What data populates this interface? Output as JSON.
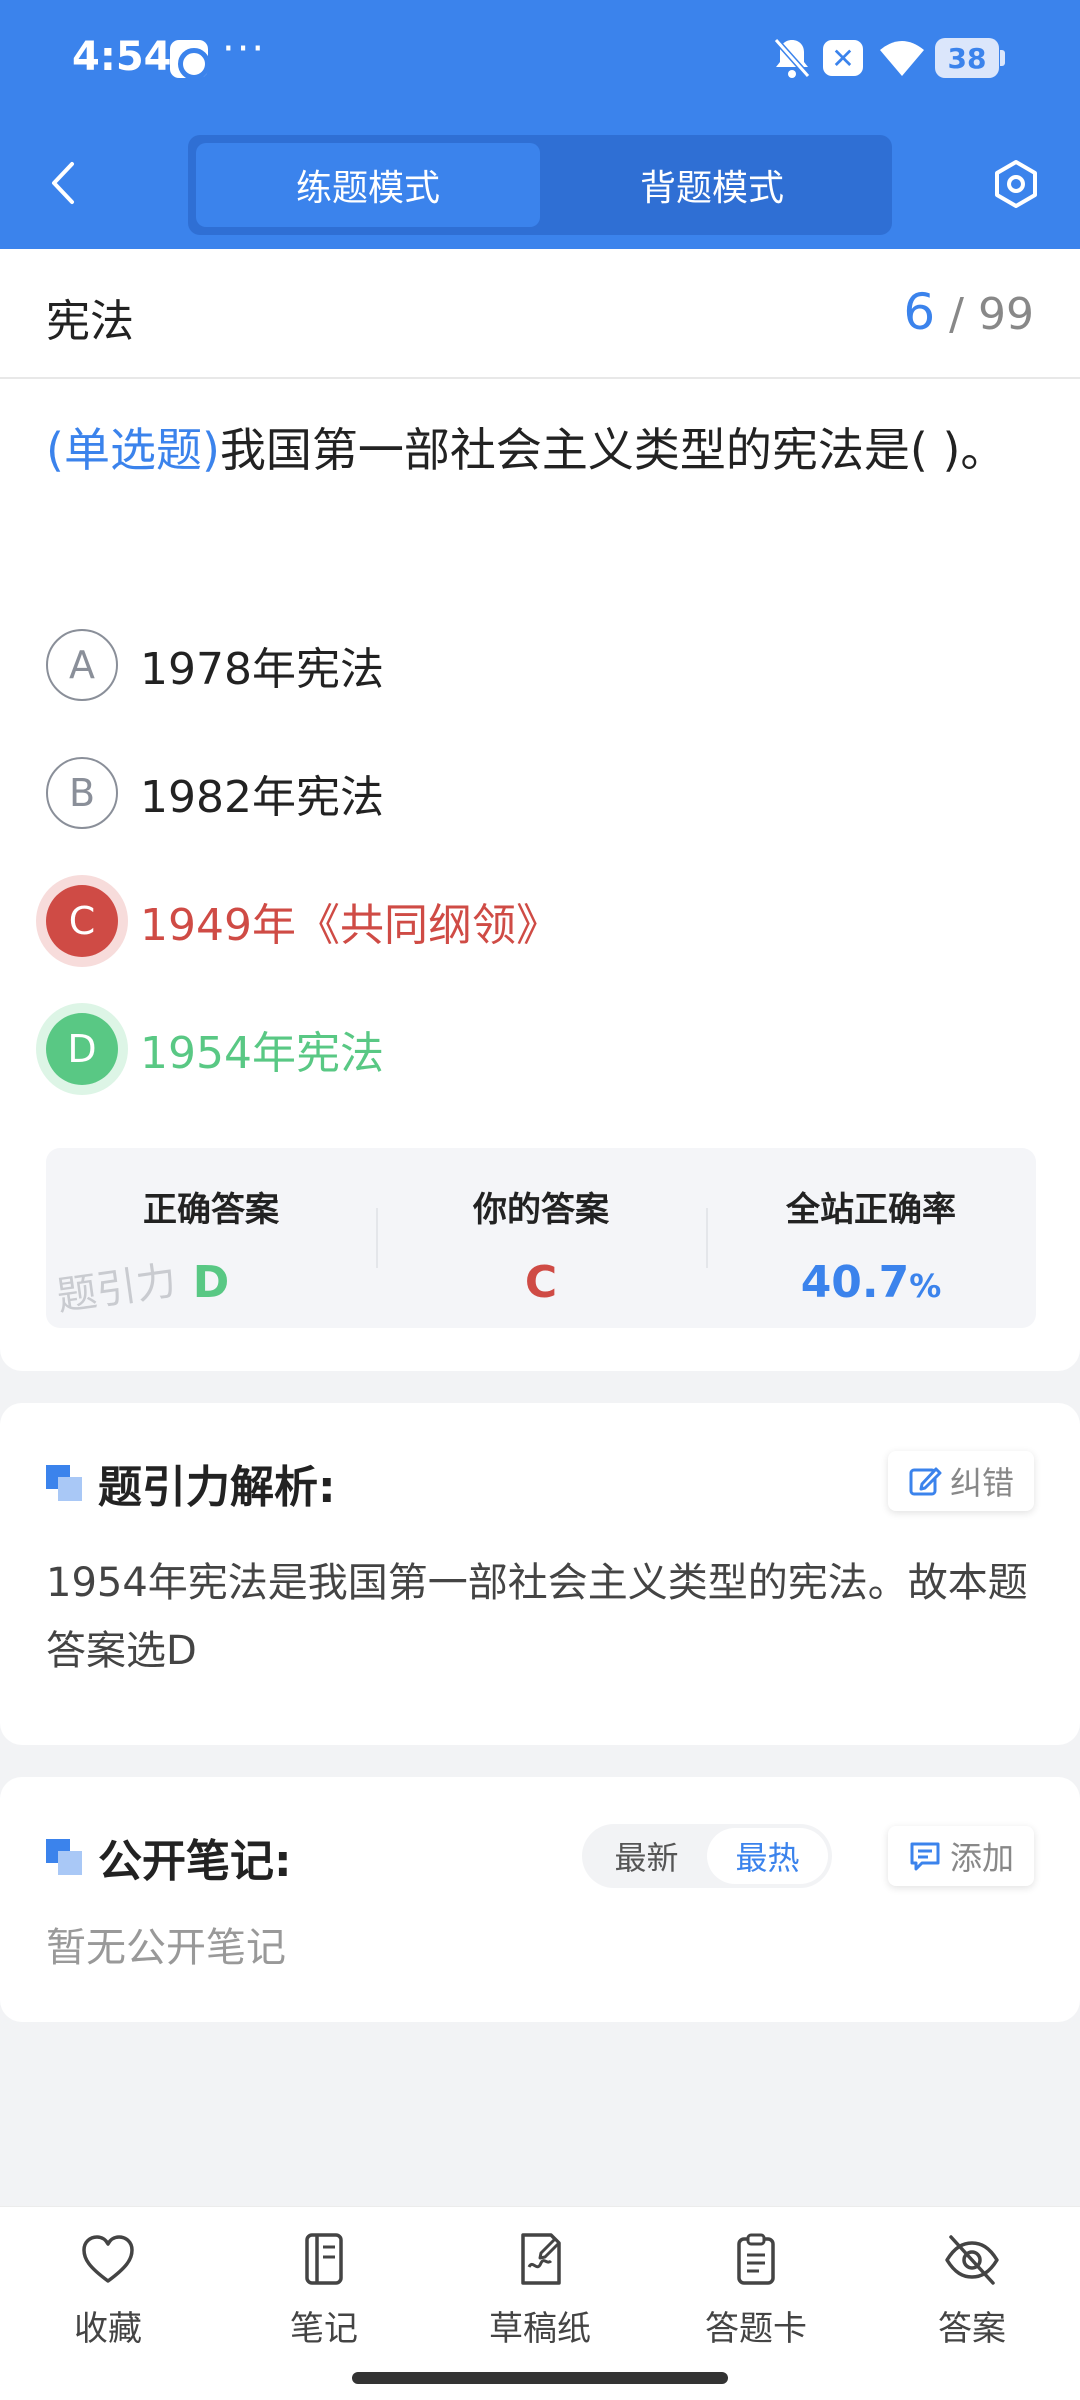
{
  "status_bar": {
    "time": "4:54",
    "dots": "···",
    "battery": "38"
  },
  "header": {
    "tabs": [
      {
        "label": "练题模式",
        "active": true
      },
      {
        "label": "背题模式",
        "active": false
      }
    ]
  },
  "question": {
    "subject": "宪法",
    "progress_current": "6",
    "progress_sep": "/",
    "progress_total": "99",
    "type_label": "(单选题)",
    "text": "我国第一部社会主义类型的宪法是(    )。",
    "options": [
      {
        "letter": "A",
        "text": "1978年宪法",
        "state": "normal"
      },
      {
        "letter": "B",
        "text": "1982年宪法",
        "state": "normal"
      },
      {
        "letter": "C",
        "text": "1949年《共同纲领》",
        "state": "wrong"
      },
      {
        "letter": "D",
        "text": "1954年宪法",
        "state": "correct"
      }
    ]
  },
  "stats": {
    "correct_label": "正确答案",
    "correct_value": "D",
    "yours_label": "你的答案",
    "yours_value": "C",
    "rate_label": "全站正确率",
    "rate_value": "40.7",
    "rate_unit": "%",
    "watermark": "题引力"
  },
  "analysis": {
    "title": "题引力解析:",
    "report_label": "纠错",
    "text": "1954年宪法是我国第一部社会主义类型的宪法。故本题答案选D"
  },
  "notes": {
    "title": "公开笔记:",
    "sort_options": [
      {
        "label": "最新",
        "active": false
      },
      {
        "label": "最热",
        "active": true
      }
    ],
    "add_label": "添加",
    "empty_text": "暂无公开笔记"
  },
  "bottom_nav": {
    "items": [
      {
        "label": "收藏",
        "icon": "heart-icon"
      },
      {
        "label": "笔记",
        "icon": "notebook-icon"
      },
      {
        "label": "草稿纸",
        "icon": "draft-paper-icon"
      },
      {
        "label": "答题卡",
        "icon": "answer-sheet-icon"
      },
      {
        "label": "答案",
        "icon": "eye-off-icon"
      }
    ]
  },
  "colors": {
    "primary": "#3b83ec",
    "wrong": "#cf4b45",
    "correct": "#59c884"
  }
}
